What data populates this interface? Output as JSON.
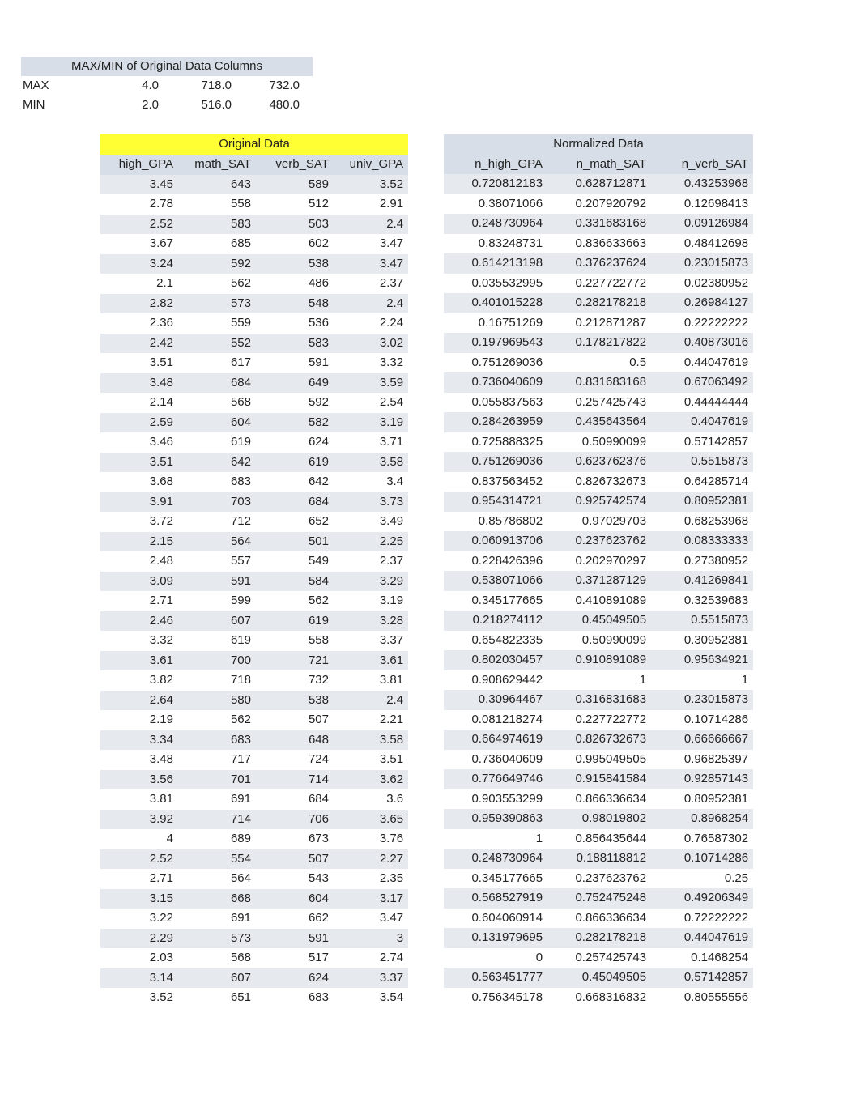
{
  "summary": {
    "title": "MAX/MIN of Original Data Columns",
    "rows": [
      {
        "label": "MAX",
        "v1": "4.0",
        "v2": "718.0",
        "v3": "732.0"
      },
      {
        "label": "MIN",
        "v1": "2.0",
        "v2": "516.0",
        "v3": "480.0"
      }
    ]
  },
  "original": {
    "title": "Original Data",
    "headers": [
      "high_GPA",
      "math_SAT",
      "verb_SAT",
      "univ_GPA"
    ],
    "rows": [
      [
        "3.45",
        "643",
        "589",
        "3.52"
      ],
      [
        "2.78",
        "558",
        "512",
        "2.91"
      ],
      [
        "2.52",
        "583",
        "503",
        "2.4"
      ],
      [
        "3.67",
        "685",
        "602",
        "3.47"
      ],
      [
        "3.24",
        "592",
        "538",
        "3.47"
      ],
      [
        "2.1",
        "562",
        "486",
        "2.37"
      ],
      [
        "2.82",
        "573",
        "548",
        "2.4"
      ],
      [
        "2.36",
        "559",
        "536",
        "2.24"
      ],
      [
        "2.42",
        "552",
        "583",
        "3.02"
      ],
      [
        "3.51",
        "617",
        "591",
        "3.32"
      ],
      [
        "3.48",
        "684",
        "649",
        "3.59"
      ],
      [
        "2.14",
        "568",
        "592",
        "2.54"
      ],
      [
        "2.59",
        "604",
        "582",
        "3.19"
      ],
      [
        "3.46",
        "619",
        "624",
        "3.71"
      ],
      [
        "3.51",
        "642",
        "619",
        "3.58"
      ],
      [
        "3.68",
        "683",
        "642",
        "3.4"
      ],
      [
        "3.91",
        "703",
        "684",
        "3.73"
      ],
      [
        "3.72",
        "712",
        "652",
        "3.49"
      ],
      [
        "2.15",
        "564",
        "501",
        "2.25"
      ],
      [
        "2.48",
        "557",
        "549",
        "2.37"
      ],
      [
        "3.09",
        "591",
        "584",
        "3.29"
      ],
      [
        "2.71",
        "599",
        "562",
        "3.19"
      ],
      [
        "2.46",
        "607",
        "619",
        "3.28"
      ],
      [
        "3.32",
        "619",
        "558",
        "3.37"
      ],
      [
        "3.61",
        "700",
        "721",
        "3.61"
      ],
      [
        "3.82",
        "718",
        "732",
        "3.81"
      ],
      [
        "2.64",
        "580",
        "538",
        "2.4"
      ],
      [
        "2.19",
        "562",
        "507",
        "2.21"
      ],
      [
        "3.34",
        "683",
        "648",
        "3.58"
      ],
      [
        "3.48",
        "717",
        "724",
        "3.51"
      ],
      [
        "3.56",
        "701",
        "714",
        "3.62"
      ],
      [
        "3.81",
        "691",
        "684",
        "3.6"
      ],
      [
        "3.92",
        "714",
        "706",
        "3.65"
      ],
      [
        "4",
        "689",
        "673",
        "3.76"
      ],
      [
        "2.52",
        "554",
        "507",
        "2.27"
      ],
      [
        "2.71",
        "564",
        "543",
        "2.35"
      ],
      [
        "3.15",
        "668",
        "604",
        "3.17"
      ],
      [
        "3.22",
        "691",
        "662",
        "3.47"
      ],
      [
        "2.29",
        "573",
        "591",
        "3"
      ],
      [
        "2.03",
        "568",
        "517",
        "2.74"
      ],
      [
        "3.14",
        "607",
        "624",
        "3.37"
      ],
      [
        "3.52",
        "651",
        "683",
        "3.54"
      ]
    ]
  },
  "normalized": {
    "title": "Normalized Data",
    "headers": [
      "n_high_GPA",
      "n_math_SAT",
      "n_verb_SAT"
    ],
    "rows": [
      [
        "0.720812183",
        "0.628712871",
        "0.43253968"
      ],
      [
        "0.38071066",
        "0.207920792",
        "0.12698413"
      ],
      [
        "0.248730964",
        "0.331683168",
        "0.09126984"
      ],
      [
        "0.83248731",
        "0.836633663",
        "0.48412698"
      ],
      [
        "0.614213198",
        "0.376237624",
        "0.23015873"
      ],
      [
        "0.035532995",
        "0.227722772",
        "0.02380952"
      ],
      [
        "0.401015228",
        "0.282178218",
        "0.26984127"
      ],
      [
        "0.16751269",
        "0.212871287",
        "0.22222222"
      ],
      [
        "0.197969543",
        "0.178217822",
        "0.40873016"
      ],
      [
        "0.751269036",
        "0.5",
        "0.44047619"
      ],
      [
        "0.736040609",
        "0.831683168",
        "0.67063492"
      ],
      [
        "0.055837563",
        "0.257425743",
        "0.44444444"
      ],
      [
        "0.284263959",
        "0.435643564",
        "0.4047619"
      ],
      [
        "0.725888325",
        "0.50990099",
        "0.57142857"
      ],
      [
        "0.751269036",
        "0.623762376",
        "0.5515873"
      ],
      [
        "0.837563452",
        "0.826732673",
        "0.64285714"
      ],
      [
        "0.954314721",
        "0.925742574",
        "0.80952381"
      ],
      [
        "0.85786802",
        "0.97029703",
        "0.68253968"
      ],
      [
        "0.060913706",
        "0.237623762",
        "0.08333333"
      ],
      [
        "0.228426396",
        "0.202970297",
        "0.27380952"
      ],
      [
        "0.538071066",
        "0.371287129",
        "0.41269841"
      ],
      [
        "0.345177665",
        "0.410891089",
        "0.32539683"
      ],
      [
        "0.218274112",
        "0.45049505",
        "0.5515873"
      ],
      [
        "0.654822335",
        "0.50990099",
        "0.30952381"
      ],
      [
        "0.802030457",
        "0.910891089",
        "0.95634921"
      ],
      [
        "0.908629442",
        "1",
        "1"
      ],
      [
        "0.30964467",
        "0.316831683",
        "0.23015873"
      ],
      [
        "0.081218274",
        "0.227722772",
        "0.10714286"
      ],
      [
        "0.664974619",
        "0.826732673",
        "0.66666667"
      ],
      [
        "0.736040609",
        "0.995049505",
        "0.96825397"
      ],
      [
        "0.776649746",
        "0.915841584",
        "0.92857143"
      ],
      [
        "0.903553299",
        "0.866336634",
        "0.80952381"
      ],
      [
        "0.959390863",
        "0.98019802",
        "0.8968254"
      ],
      [
        "1",
        "0.856435644",
        "0.76587302"
      ],
      [
        "0.248730964",
        "0.188118812",
        "0.10714286"
      ],
      [
        "0.345177665",
        "0.237623762",
        "0.25"
      ],
      [
        "0.568527919",
        "0.752475248",
        "0.49206349"
      ],
      [
        "0.604060914",
        "0.866336634",
        "0.72222222"
      ],
      [
        "0.131979695",
        "0.282178218",
        "0.44047619"
      ],
      [
        "0",
        "0.257425743",
        "0.1468254"
      ],
      [
        "0.563451777",
        "0.45049505",
        "0.57142857"
      ],
      [
        "0.756345178",
        "0.668316832",
        "0.80555556"
      ]
    ]
  }
}
